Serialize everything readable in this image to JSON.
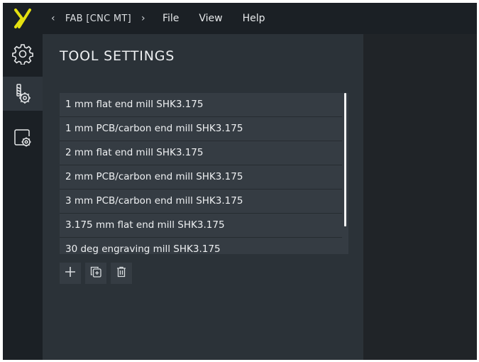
{
  "app": {
    "logo_icon": "x-logo-icon",
    "accent_color": "#e5e010"
  },
  "rail": {
    "items": [
      {
        "icon": "gear-icon",
        "active": false
      },
      {
        "icon": "tool-settings-icon",
        "active": true
      },
      {
        "icon": "machine-settings-icon",
        "active": false
      }
    ]
  },
  "topbar": {
    "breadcrumb": {
      "prev_icon": "chevron-left-icon",
      "label": "FAB [CNC MT]",
      "next_icon": "chevron-right-icon"
    },
    "menu": [
      "File",
      "View",
      "Help"
    ]
  },
  "settings": {
    "title": "TOOL SETTINGS",
    "tools": [
      "1 mm flat end mill SHK3.175",
      "1 mm PCB/carbon end mill SHK3.175",
      "2 mm flat end mill SHK3.175",
      "2 mm PCB/carbon end mill SHK3.175",
      "3 mm PCB/carbon end mill SHK3.175",
      "3.175 mm flat end mill SHK3.175",
      "30 deg engraving mill SHK3.175"
    ],
    "actions": [
      {
        "icon": "plus-icon"
      },
      {
        "icon": "duplicate-icon"
      },
      {
        "icon": "trash-icon"
      }
    ]
  }
}
